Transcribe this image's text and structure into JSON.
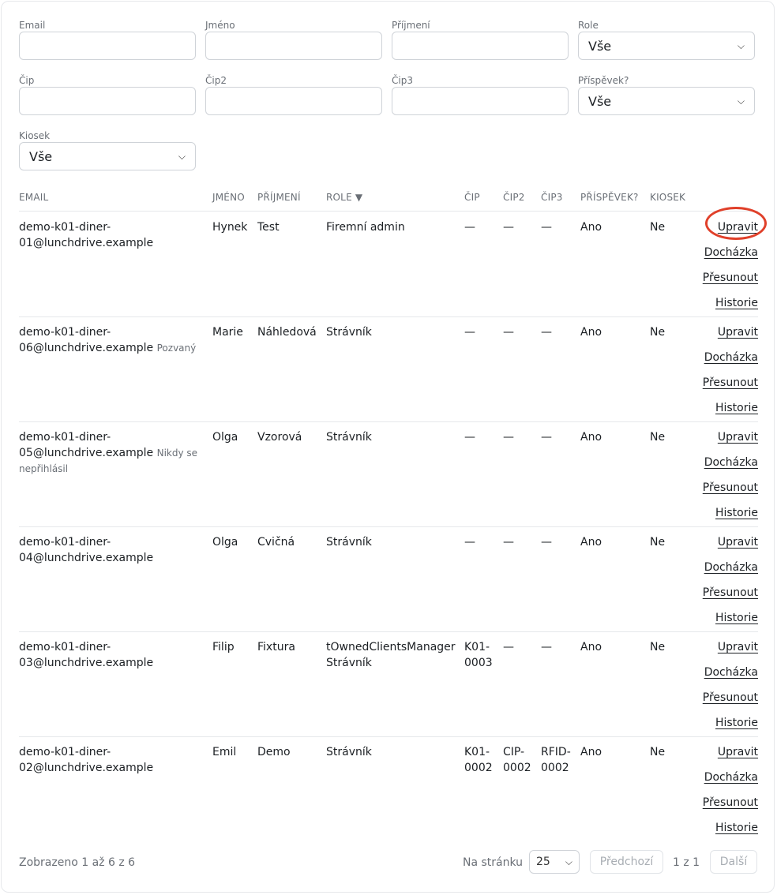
{
  "filters": {
    "email": {
      "label": "Email",
      "value": ""
    },
    "first_name": {
      "label": "Jméno",
      "value": ""
    },
    "last_name": {
      "label": "Příjmení",
      "value": ""
    },
    "role": {
      "label": "Role",
      "selected": "Vše"
    },
    "chip": {
      "label": "Čip",
      "value": ""
    },
    "chip2": {
      "label": "Čip2",
      "value": ""
    },
    "chip3": {
      "label": "Čip3",
      "value": ""
    },
    "contribution": {
      "label": "Příspěvek?",
      "selected": "Vše"
    },
    "kiosk": {
      "label": "Kiosek",
      "selected": "Vše"
    }
  },
  "table": {
    "columns": {
      "email": "EMAIL",
      "first_name": "JMÉNO",
      "last_name": "PŘÍJMENÍ",
      "role": "ROLE ▼",
      "chip": "ČIP",
      "chip2": "ČIP2",
      "chip3": "ČIP3",
      "contribution": "PŘÍSPĚVEK?",
      "kiosk": "KIOSEK"
    },
    "actions": {
      "edit": "Upravit",
      "attendance": "Docházka",
      "move": "Přesunout",
      "history": "Historie"
    },
    "rows": [
      {
        "email1": "demo-k01-diner-",
        "email2": "01@lunchdrive.example",
        "status": "",
        "first_name": "Hynek",
        "last_name": "Test",
        "role1": "Firemní admin",
        "role2": "",
        "chip1": "—",
        "chip2a": "",
        "c21": "—",
        "c22": "",
        "c31": "—",
        "c32": "",
        "contribution": "Ano",
        "kiosk": "Ne"
      },
      {
        "email1": "demo-k01-diner-",
        "email2": "06@lunchdrive.example",
        "status": "Pozvaný",
        "first_name": "Marie",
        "last_name": "Náhledová",
        "role1": "Strávník",
        "role2": "",
        "chip1": "—",
        "chip2a": "",
        "c21": "—",
        "c22": "",
        "c31": "—",
        "c32": "",
        "contribution": "Ano",
        "kiosk": "Ne"
      },
      {
        "email1": "demo-k01-diner-",
        "email2": "05@lunchdrive.example",
        "status": "Nikdy se",
        "status2": "nepřihlásil",
        "first_name": "Olga",
        "last_name": "Vzorová",
        "role1": "Strávník",
        "role2": "",
        "chip1": "—",
        "chip2a": "",
        "c21": "—",
        "c22": "",
        "c31": "—",
        "c32": "",
        "contribution": "Ano",
        "kiosk": "Ne"
      },
      {
        "email1": "demo-k01-diner-",
        "email2": "04@lunchdrive.example",
        "status": "",
        "first_name": "Olga",
        "last_name": "Cvičná",
        "role1": "Strávník",
        "role2": "",
        "chip1": "—",
        "chip2a": "",
        "c21": "—",
        "c22": "",
        "c31": "—",
        "c32": "",
        "contribution": "Ano",
        "kiosk": "Ne"
      },
      {
        "email1": "demo-k01-diner-",
        "email2": "03@lunchdrive.example",
        "status": "",
        "first_name": "Filip",
        "last_name": "Fixtura",
        "role1": "tOwnedClientsManager",
        "role2": "Strávník",
        "chip1": "K01-",
        "chip2a": "0003",
        "c21": "—",
        "c22": "",
        "c31": "—",
        "c32": "",
        "contribution": "Ano",
        "kiosk": "Ne"
      },
      {
        "email1": "demo-k01-diner-",
        "email2": "02@lunchdrive.example",
        "status": "",
        "first_name": "Emil",
        "last_name": "Demo",
        "role1": "Strávník",
        "role2": "",
        "chip1": "K01-",
        "chip2a": "0002",
        "c21": "CIP-",
        "c22": "0002",
        "c31": "RFID-",
        "c32": "0002",
        "contribution": "Ano",
        "kiosk": "Ne"
      }
    ]
  },
  "footer": {
    "count_text": "Zobrazeno 1 až 6 z 6",
    "per_page_label": "Na stránku",
    "per_page_value": "25",
    "prev": "Předchozí",
    "page_text": "1 z 1",
    "next": "Další"
  }
}
